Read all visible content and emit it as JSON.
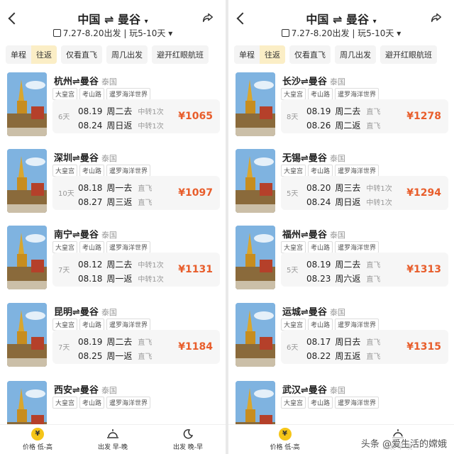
{
  "left": {
    "title_from": "中国",
    "title_to": "曼谷",
    "swap_glyph": "⇌",
    "caret": "▾",
    "date_range": "7.27-8.20出发",
    "duration": "玩5-10天",
    "seg_oneway": "单程",
    "seg_round": "往返",
    "f_direct": "仅看直飞",
    "f_weekday": "周几出发",
    "f_redeye": "避开红眼航班",
    "cards": [
      {
        "from": "杭州",
        "to": "曼谷",
        "country": "泰国",
        "tags": [
          "大皇宫",
          "考山路",
          "暹罗海洋世界"
        ],
        "days": "6天",
        "d1": "08.19",
        "w1": "周二去",
        "t1": "中转1次",
        "d2": "08.24",
        "w2": "周日返",
        "t2": "中转1次",
        "price": "¥1065"
      },
      {
        "from": "深圳",
        "to": "曼谷",
        "country": "泰国",
        "tags": [
          "大皇宫",
          "考山路",
          "暹罗海洋世界"
        ],
        "days": "10天",
        "d1": "08.18",
        "w1": "周一去",
        "t1": "直飞",
        "d2": "08.27",
        "w2": "周三返",
        "t2": "直飞",
        "price": "¥1097"
      },
      {
        "from": "南宁",
        "to": "曼谷",
        "country": "泰国",
        "tags": [
          "大皇宫",
          "考山路",
          "暹罗海洋世界"
        ],
        "days": "7天",
        "d1": "08.12",
        "w1": "周二去",
        "t1": "中转1次",
        "d2": "08.18",
        "w2": "周一返",
        "t2": "中转1次",
        "price": "¥1131"
      },
      {
        "from": "昆明",
        "to": "曼谷",
        "country": "泰国",
        "tags": [
          "大皇宫",
          "考山路",
          "暹罗海洋世界"
        ],
        "days": "7天",
        "d1": "08.19",
        "w1": "周二去",
        "t1": "直飞",
        "d2": "08.25",
        "w2": "周一返",
        "t2": "直飞",
        "price": "¥1184"
      },
      {
        "from": "西安",
        "to": "曼谷",
        "country": "泰国",
        "tags": [
          "大皇宫",
          "考山路",
          "暹罗海洋世界"
        ],
        "days": "",
        "d1": "",
        "w1": "",
        "t1": "",
        "d2": "",
        "w2": "",
        "t2": "",
        "price": ""
      }
    ],
    "tab_price": "价格 低-高",
    "tab_dep_early": "出发 早-晚",
    "tab_dep_late": "出发 晚-早"
  },
  "right": {
    "title_from": "中国",
    "title_to": "曼谷",
    "swap_glyph": "⇌",
    "caret": "▾",
    "date_range": "7.27-8.20出发",
    "duration": "玩5-10天",
    "seg_oneway": "单程",
    "seg_round": "往返",
    "f_direct": "仅看直飞",
    "f_weekday": "周几出发",
    "f_redeye": "避开红眼航班",
    "cards": [
      {
        "from": "长沙",
        "to": "曼谷",
        "country": "泰国",
        "tags": [
          "大皇宫",
          "考山路",
          "暹罗海洋世界"
        ],
        "days": "8天",
        "d1": "08.19",
        "w1": "周二去",
        "t1": "直飞",
        "d2": "08.26",
        "w2": "周二返",
        "t2": "直飞",
        "price": "¥1278"
      },
      {
        "from": "无锡",
        "to": "曼谷",
        "country": "泰国",
        "tags": [
          "大皇宫",
          "考山路",
          "暹罗海洋世界"
        ],
        "days": "5天",
        "d1": "08.20",
        "w1": "周三去",
        "t1": "中转1次",
        "d2": "08.24",
        "w2": "周日返",
        "t2": "中转1次",
        "price": "¥1294"
      },
      {
        "from": "福州",
        "to": "曼谷",
        "country": "泰国",
        "tags": [
          "大皇宫",
          "考山路",
          "暹罗海洋世界"
        ],
        "days": "5天",
        "d1": "08.19",
        "w1": "周二去",
        "t1": "直飞",
        "d2": "08.23",
        "w2": "周六返",
        "t2": "直飞",
        "price": "¥1313"
      },
      {
        "from": "运城",
        "to": "曼谷",
        "country": "泰国",
        "tags": [
          "大皇宫",
          "考山路",
          "暹罗海洋世界"
        ],
        "days": "6天",
        "d1": "08.17",
        "w1": "周日去",
        "t1": "直飞",
        "d2": "08.22",
        "w2": "周五返",
        "t2": "直飞",
        "price": "¥1315"
      },
      {
        "from": "武汉",
        "to": "曼谷",
        "country": "泰国",
        "tags": [
          "大皇宫",
          "考山路",
          "暹罗海洋世界"
        ],
        "days": "",
        "d1": "",
        "w1": "",
        "t1": "",
        "d2": "",
        "w2": "",
        "t2": "",
        "price": ""
      }
    ],
    "tab_price": "价格 低-高",
    "tab_dep_early": "出发 早-晚",
    "watermark": "头条 @爱生活的嫦娥"
  },
  "colors": {
    "accent_price": "#e85d2b",
    "segment_active": "#fbeec6",
    "coin": "#f5c518"
  },
  "icons": [
    "back-icon",
    "share-icon",
    "calendar-icon",
    "coin-icon",
    "sunrise-icon",
    "moon-icon"
  ]
}
